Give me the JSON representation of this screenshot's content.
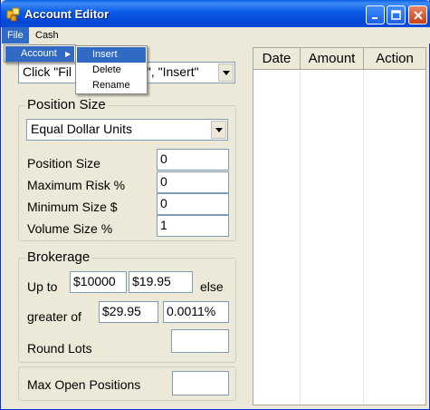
{
  "window": {
    "title": "Account Editor"
  },
  "menubar": {
    "file": "File",
    "cash": "Cash"
  },
  "file_menu": {
    "account": "Account",
    "arrow": "▶"
  },
  "account_submenu": {
    "insert": "Insert",
    "delete": "Delete",
    "rename": "Rename"
  },
  "account_combo": {
    "value_left": "Click \"Fil",
    "value_right": "t\", \"Insert\""
  },
  "position_size": {
    "legend": "Position Size",
    "method": "Equal Dollar Units",
    "fields": [
      {
        "label": "Position Size",
        "value": "0"
      },
      {
        "label": "Maximum Risk %",
        "value": "0"
      },
      {
        "label": "Minimum Size $",
        "value": "0"
      },
      {
        "label": "Volume Size %",
        "value": "1"
      }
    ]
  },
  "brokerage": {
    "legend": "Brokerage",
    "up_to_label": "Up to",
    "up_to_amount": "$10000",
    "up_to_fee": "$19.95",
    "else_label": "else",
    "greater_label": "greater of",
    "greater_fee": "$29.95",
    "greater_pct": "0.0011%",
    "round_lots_label": "Round Lots",
    "round_lots_value": ""
  },
  "max_open": {
    "label": "Max Open Positions",
    "value": ""
  },
  "grid": {
    "columns": [
      "Date",
      "Amount",
      "Action"
    ]
  }
}
